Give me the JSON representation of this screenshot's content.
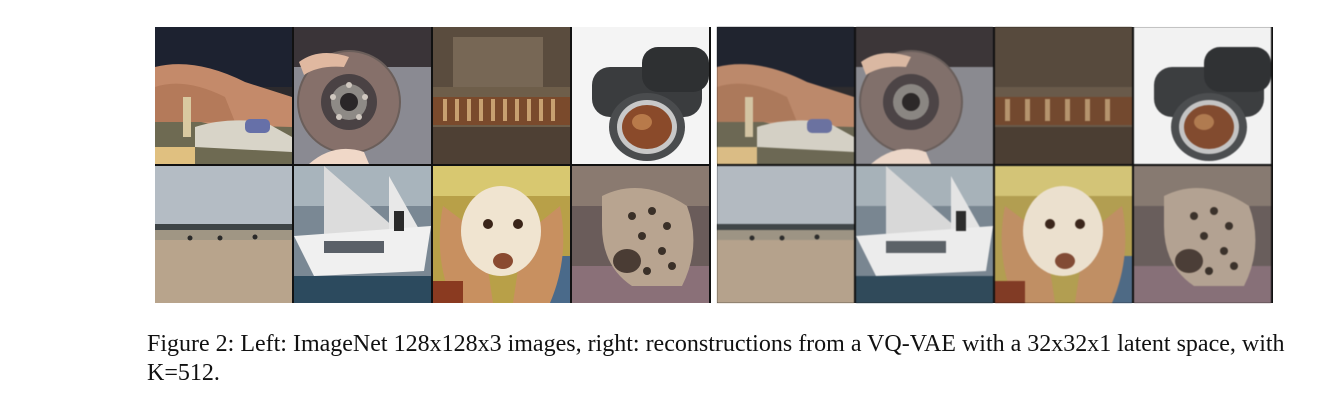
{
  "figure": {
    "panels": [
      {
        "side": "left",
        "tiles": [
          {
            "subject": "hand-sewing"
          },
          {
            "subject": "brake-disc"
          },
          {
            "subject": "shelf-scene"
          },
          {
            "subject": "binoculars"
          },
          {
            "subject": "beach"
          },
          {
            "subject": "sailboat"
          },
          {
            "subject": "spaniel"
          },
          {
            "subject": "hyena"
          }
        ]
      },
      {
        "side": "right",
        "tiles": [
          {
            "subject": "hand-sewing"
          },
          {
            "subject": "brake-disc"
          },
          {
            "subject": "shelf-scene"
          },
          {
            "subject": "binoculars"
          },
          {
            "subject": "beach"
          },
          {
            "subject": "sailboat"
          },
          {
            "subject": "spaniel"
          },
          {
            "subject": "hyena"
          }
        ]
      }
    ],
    "caption": "Figure 2: Left: ImageNet 128x128x3 images, right: reconstructions from a VQ-VAE with a 32x32x1 latent space, with K=512."
  }
}
